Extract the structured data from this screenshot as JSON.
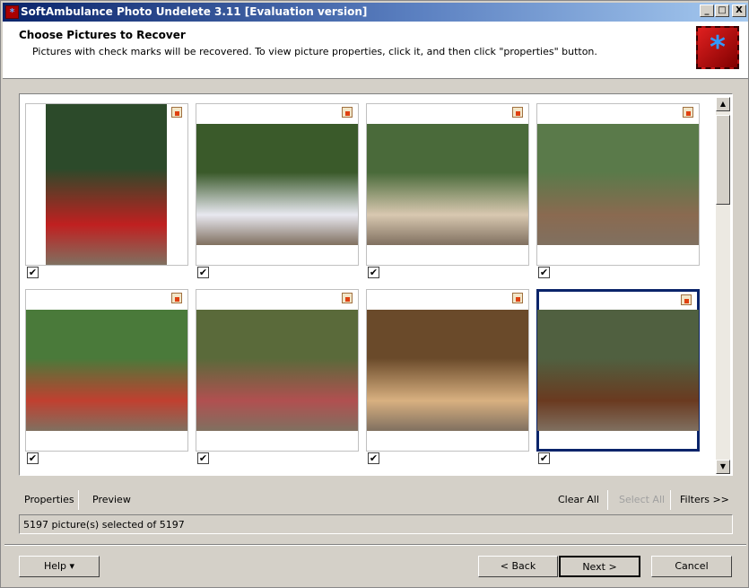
{
  "window": {
    "title": "SoftAmbulance Photo Undelete 3.11 [Evaluation version]",
    "min": "_",
    "max": "□",
    "close": "X"
  },
  "header": {
    "title": "Choose Pictures to Recover",
    "subtitle": "Pictures with check marks will be recovered. To view picture properties, click it, and then click \"properties\" button.",
    "logo_glyph": "*"
  },
  "pictures": [
    {
      "checked": true,
      "orientation": "portrait",
      "colors": [
        "#2c4a2a",
        "#c02020"
      ]
    },
    {
      "checked": true,
      "orientation": "landscape",
      "colors": [
        "#3a5a2a",
        "#e8e8f0"
      ]
    },
    {
      "checked": true,
      "orientation": "landscape",
      "colors": [
        "#4a6a3a",
        "#d8c8b0"
      ]
    },
    {
      "checked": true,
      "orientation": "landscape",
      "colors": [
        "#5a7a4a",
        "#8a6a50"
      ]
    },
    {
      "checked": true,
      "orientation": "landscape",
      "colors": [
        "#4a7a3a",
        "#c04030"
      ]
    },
    {
      "checked": true,
      "orientation": "landscape",
      "colors": [
        "#5a6a3a",
        "#b05050"
      ]
    },
    {
      "checked": true,
      "orientation": "landscape",
      "colors": [
        "#6a4a2a",
        "#d8b080"
      ]
    },
    {
      "checked": true,
      "orientation": "landscape",
      "colors": [
        "#506040",
        "#6a3a20"
      ],
      "selected": true
    }
  ],
  "checkmark": "✔",
  "toolbar": {
    "properties": "Properties",
    "preview": "Preview",
    "clear_all": "Clear All",
    "select_all": "Select All",
    "filters": "Filters >>"
  },
  "status": "5197 picture(s) selected of 5197",
  "buttons": {
    "help": "Help ▾",
    "back": "< Back",
    "next": "Next >",
    "cancel": "Cancel"
  },
  "scroll": {
    "up": "▲",
    "down": "▼"
  }
}
